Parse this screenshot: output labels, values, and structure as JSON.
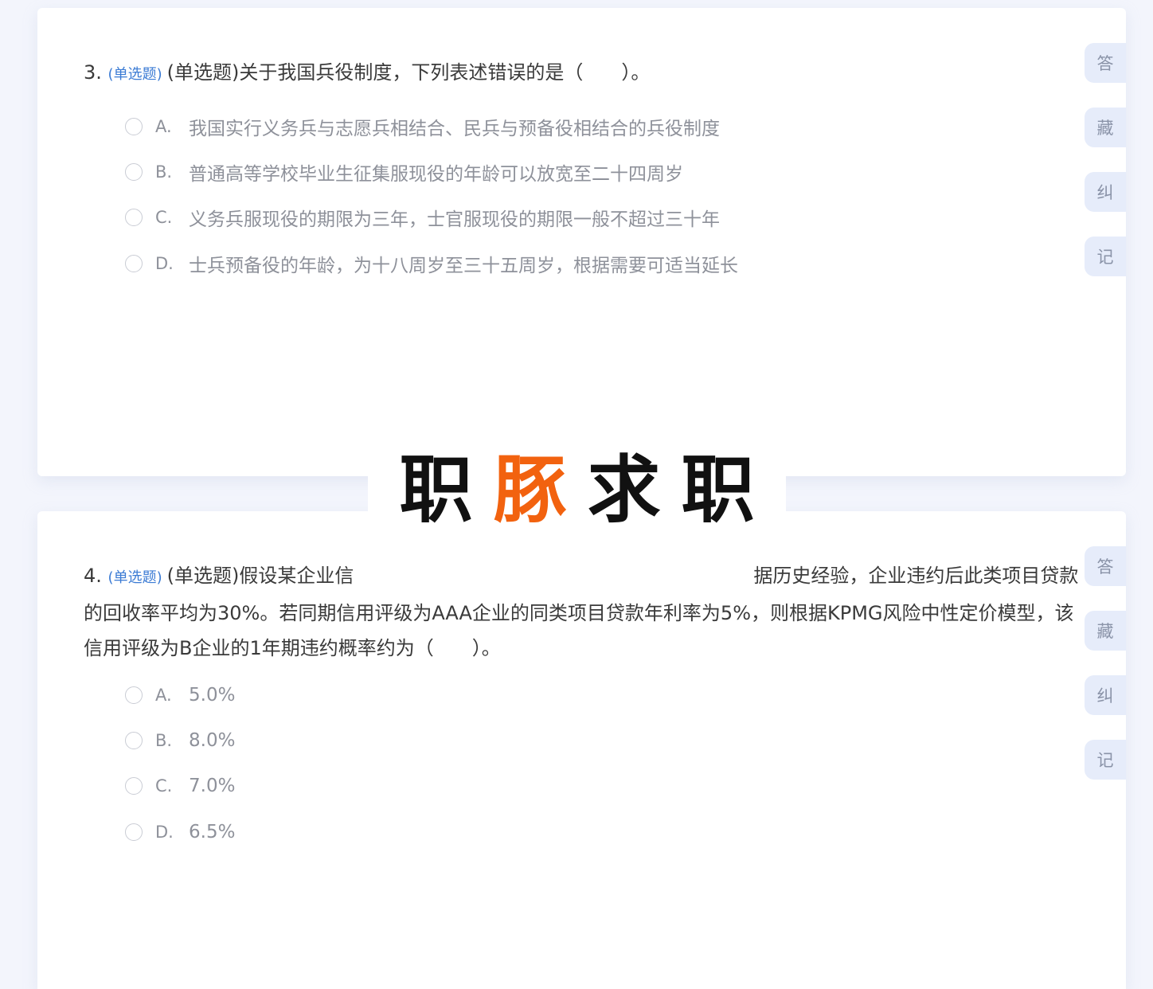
{
  "questions": [
    {
      "number": "3.",
      "type_tag": "(单选题)",
      "stem": "(单选题)关于我国兵役制度，下列表述错误的是（　　）。",
      "options": [
        {
          "letter": "A.",
          "text": "我国实行义务兵与志愿兵相结合、民兵与预备役相结合的兵役制度"
        },
        {
          "letter": "B.",
          "text": "普通高等学校毕业生征集服现役的年龄可以放宽至二十四周岁"
        },
        {
          "letter": "C.",
          "text": "义务兵服现役的期限为三年，士官服现役的期限一般不超过三十年"
        },
        {
          "letter": "D.",
          "text": "士兵预备役的年龄，为十八周岁至三十五周岁，根据需要可适当延长"
        }
      ],
      "tools": [
        "答",
        "藏",
        "纠",
        "记"
      ]
    },
    {
      "number": "4.",
      "type_tag": "(单选题)",
      "stem_before_watermark": "(单选题)假设某企业信",
      "stem_after_watermark": "据历史经验，企业违约后此类项目贷款的回收率平均为30%。若同期信用评级为AAA企业的同类项目贷款年利率为5%，则根据KPMG风险中性定价模型，该信用评级为B企业的1年期违约概率约为（　　）。",
      "options": [
        {
          "letter": "A.",
          "text": "5.0%"
        },
        {
          "letter": "B.",
          "text": "8.0%"
        },
        {
          "letter": "C.",
          "text": "7.0%"
        },
        {
          "letter": "D.",
          "text": "6.5%"
        }
      ],
      "tools": [
        "答",
        "藏",
        "纠",
        "记"
      ]
    }
  ],
  "watermark": {
    "chars": [
      "职",
      "豚",
      "求",
      "职"
    ],
    "accent_color": "#f2620f"
  }
}
